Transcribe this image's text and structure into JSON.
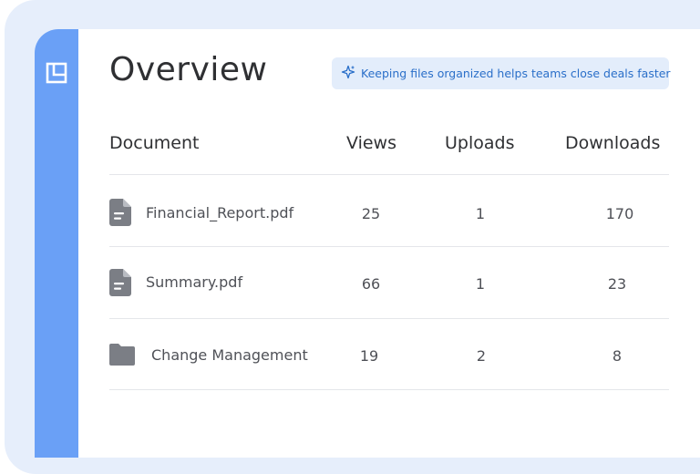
{
  "page": {
    "title": "Overview",
    "tip": "Keeping files organized helps teams close deals faster"
  },
  "table": {
    "columns": [
      "Document",
      "Views",
      "Uploads",
      "Downloads"
    ],
    "rows": [
      {
        "type": "file",
        "name": "Financial_Report.pdf",
        "views": "25",
        "uploads": "1",
        "downloads": "170"
      },
      {
        "type": "file",
        "name": "Summary.pdf",
        "views": "66",
        "uploads": "1",
        "downloads": "23"
      },
      {
        "type": "folder",
        "name": "Change Management",
        "views": "19",
        "uploads": "2",
        "downloads": "8"
      }
    ]
  },
  "colors": {
    "sidebar": "#6aa0f6",
    "frame": "#e6eefb",
    "tip_background": "#e3edfb",
    "tip_text": "#2a6fc9",
    "icon_gray": "#7b7e85"
  },
  "icons": {
    "sidebar_logo": "layout-icon",
    "tip": "sparkle-icon",
    "file": "document-icon",
    "folder": "folder-icon"
  }
}
